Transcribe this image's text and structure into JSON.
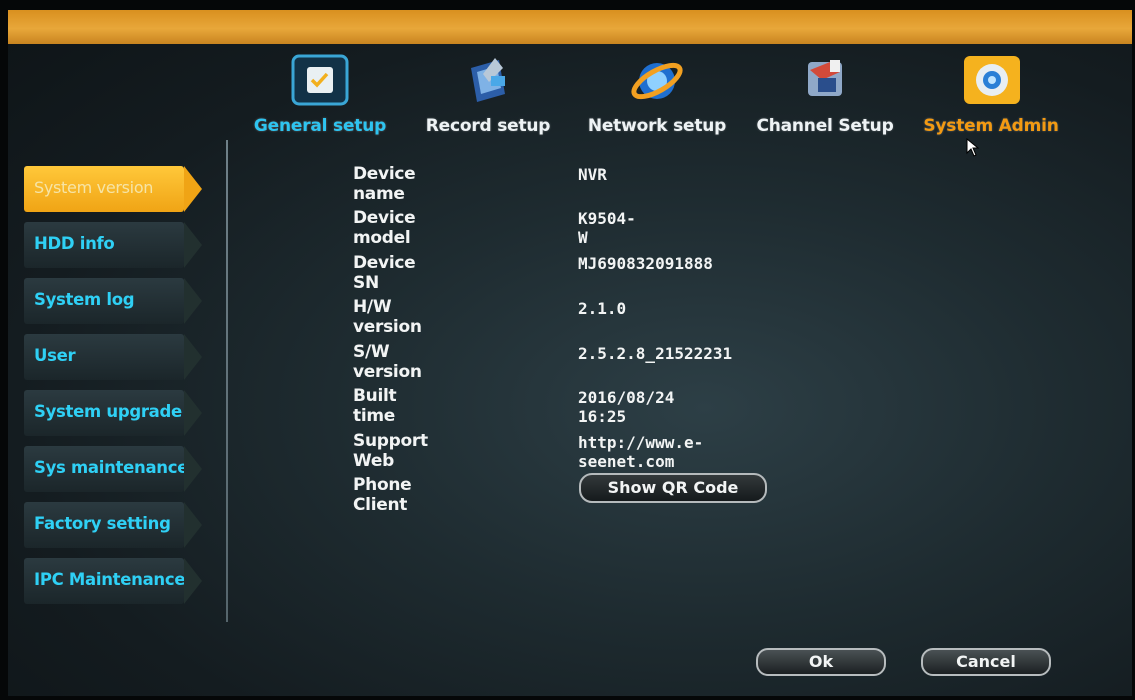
{
  "tabs": [
    {
      "label": "General setup",
      "icon": "general-setup-icon",
      "active": true
    },
    {
      "label": "Record setup",
      "icon": "record-setup-icon"
    },
    {
      "label": "Network setup",
      "icon": "network-setup-icon"
    },
    {
      "label": "Channel Setup",
      "icon": "channel-setup-icon"
    },
    {
      "label": "System Admin",
      "icon": "system-admin-icon",
      "highlighted": true
    }
  ],
  "sidebar": {
    "items": [
      {
        "label": "System version",
        "active": true
      },
      {
        "label": "HDD info"
      },
      {
        "label": "System log"
      },
      {
        "label": "User"
      },
      {
        "label": "System upgrade"
      },
      {
        "label": "Sys maintenance"
      },
      {
        "label": "Factory setting"
      },
      {
        "label": "IPC Maintenance"
      }
    ]
  },
  "info": {
    "rows": [
      {
        "label": "Device name",
        "value": "NVR"
      },
      {
        "label": "Device model",
        "value": "K9504-W"
      },
      {
        "label": "Device SN",
        "value": "MJ690832091888"
      },
      {
        "label": "H/W version",
        "value": "2.1.0"
      },
      {
        "label": "S/W version",
        "value": "2.5.2.8_21522231"
      },
      {
        "label": "Built time",
        "value": "2016/08/24 16:25"
      },
      {
        "label": "Support Web",
        "value": "http://www.e-seenet.com"
      },
      {
        "label": "Phone Client",
        "value": ""
      }
    ],
    "qr_button": "Show QR Code"
  },
  "footer": {
    "ok_label": "Ok",
    "cancel_label": "Cancel"
  },
  "colors": {
    "active_tab": "#2ec4f0",
    "admin_tab": "#f39a12",
    "sidebar_text": "#2fd0f5",
    "active_sidebar_bg": "#f0a415",
    "top_bar": "#e8a73a"
  }
}
